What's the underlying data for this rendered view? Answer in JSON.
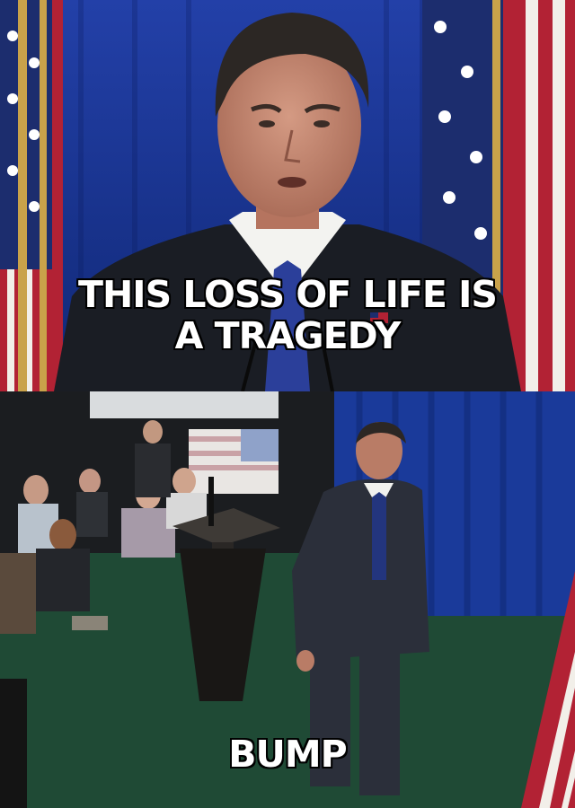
{
  "meme": {
    "top_caption": [
      "THIS LOSS OF LIFE IS",
      "A TRAGEDY"
    ],
    "bottom_caption": "BUMP"
  },
  "colors": {
    "curtain_blue": "#1a3a9a",
    "flag_red": "#b22234",
    "suit_dark": "#1c1f26",
    "carpet_green": "#1f4a35"
  }
}
